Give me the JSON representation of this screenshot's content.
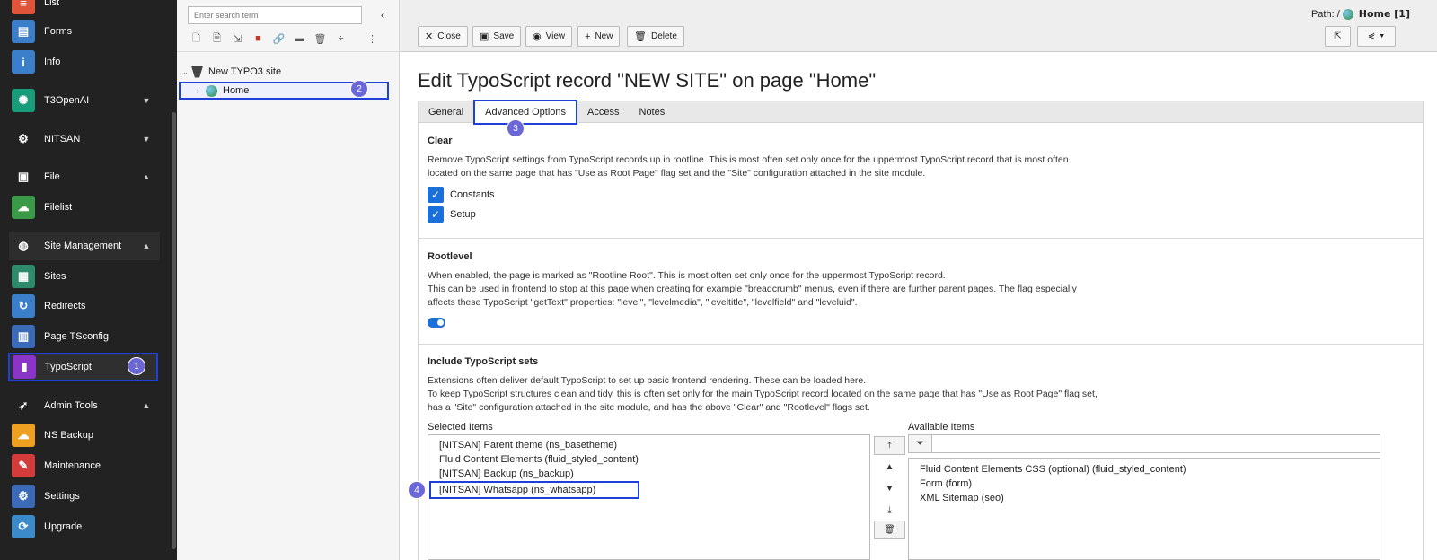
{
  "module_menu": {
    "items": [
      {
        "label": "List",
        "icon": "list-icon",
        "color": "#e0553a"
      },
      {
        "label": "Forms",
        "icon": "forms-icon",
        "color": "#3b7ec9"
      },
      {
        "label": "Info",
        "icon": "info-icon",
        "color": "#3b7ec9"
      },
      {
        "label": "T3OpenAI",
        "icon": "openai-icon",
        "color": "#1a9b7a"
      },
      {
        "label": "NITSAN",
        "icon": "gear-icon",
        "color": "#2d2d2d"
      },
      {
        "label": "File",
        "icon": "image-icon",
        "color": "#2d2d2d"
      },
      {
        "label": "Filelist",
        "icon": "cloud-icon",
        "color": "#3a9a48"
      },
      {
        "label": "Site Management",
        "icon": "globe-icon",
        "color": "#2d2d2d"
      },
      {
        "label": "Sites",
        "icon": "sites-icon",
        "color": "#2d8a6a"
      },
      {
        "label": "Redirects",
        "icon": "redirect-icon",
        "color": "#3b7ec9"
      },
      {
        "label": "Page TSconfig",
        "icon": "tsconfig-icon",
        "color": "#3b6ab8"
      },
      {
        "label": "TypoScript",
        "icon": "typoscript-icon",
        "color": "#8b35c8"
      },
      {
        "label": "Admin Tools",
        "icon": "rocket-icon",
        "color": "#2d2d2d"
      },
      {
        "label": "NS Backup",
        "icon": "backup-icon",
        "color": "#f0a020"
      },
      {
        "label": "Maintenance",
        "icon": "wrench-icon",
        "color": "#d43b3b"
      },
      {
        "label": "Settings",
        "icon": "settings-icon",
        "color": "#3b6ab8"
      },
      {
        "label": "Upgrade",
        "icon": "upgrade-icon",
        "color": "#3b8ac9"
      }
    ],
    "badge_1": "1"
  },
  "page_tree": {
    "search_placeholder": "Enter search term",
    "root_label": "New TYPO3 site",
    "home_label": "Home",
    "badge_2": "2"
  },
  "docheader": {
    "path_label": "Path: /",
    "path_page": "Home [1]",
    "buttons": {
      "close": "Close",
      "save": "Save",
      "view": "View",
      "new": "New",
      "delete": "Delete"
    }
  },
  "main": {
    "title": "Edit TypoScript record \"NEW SITE\" on page \"Home\"",
    "tabs": [
      "General",
      "Advanced Options",
      "Access",
      "Notes"
    ],
    "badge_3": "3",
    "clear": {
      "title": "Clear",
      "desc1": "Remove TypoScript settings from TypoScript records up in rootline. This is most often set only once for the uppermost TypoScript record that is most often",
      "desc2": "located on the same page that has \"Use as Root Page\" flag set and the \"Site\" configuration attached in the site module.",
      "constants": "Constants",
      "setup": "Setup"
    },
    "rootlevel": {
      "title": "Rootlevel",
      "desc1": "When enabled, the page is marked as \"Rootline Root\". This is most often set only once for the uppermost TypoScript record.",
      "desc2": "This can be used in frontend to stop at this page when creating for example \"breadcrumb\" menus, even if there are further parent pages. The flag especially",
      "desc3": "affects these TypoScript \"getText\" properties: \"level\", \"levelmedia\", \"leveltitle\", \"levelfield\" and \"leveluid\"."
    },
    "include": {
      "title": "Include TypoScript sets",
      "desc1": "Extensions often deliver default TypoScript to set up basic frontend rendering. These can be loaded here.",
      "desc2": "To keep TypoScript structures clean and tidy, this is often set only for the main TypoScript record located on the same page that has \"Use as Root Page\" flag set,",
      "desc3": "has a \"Site\" configuration attached in the site module, and has the above \"Clear\" and \"Rootlevel\" flags set.",
      "selected_label": "Selected Items",
      "available_label": "Available Items",
      "selected": [
        "[NITSAN] Parent theme (ns_basetheme)",
        "Fluid Content Elements (fluid_styled_content)",
        "[NITSAN] Backup (ns_backup)",
        "[NITSAN] Whatsapp (ns_whatsapp)"
      ],
      "available": [
        "Fluid Content Elements CSS (optional) (fluid_styled_content)",
        "Form (form)",
        "XML Sitemap (seo)"
      ],
      "badge_4": "4"
    }
  }
}
